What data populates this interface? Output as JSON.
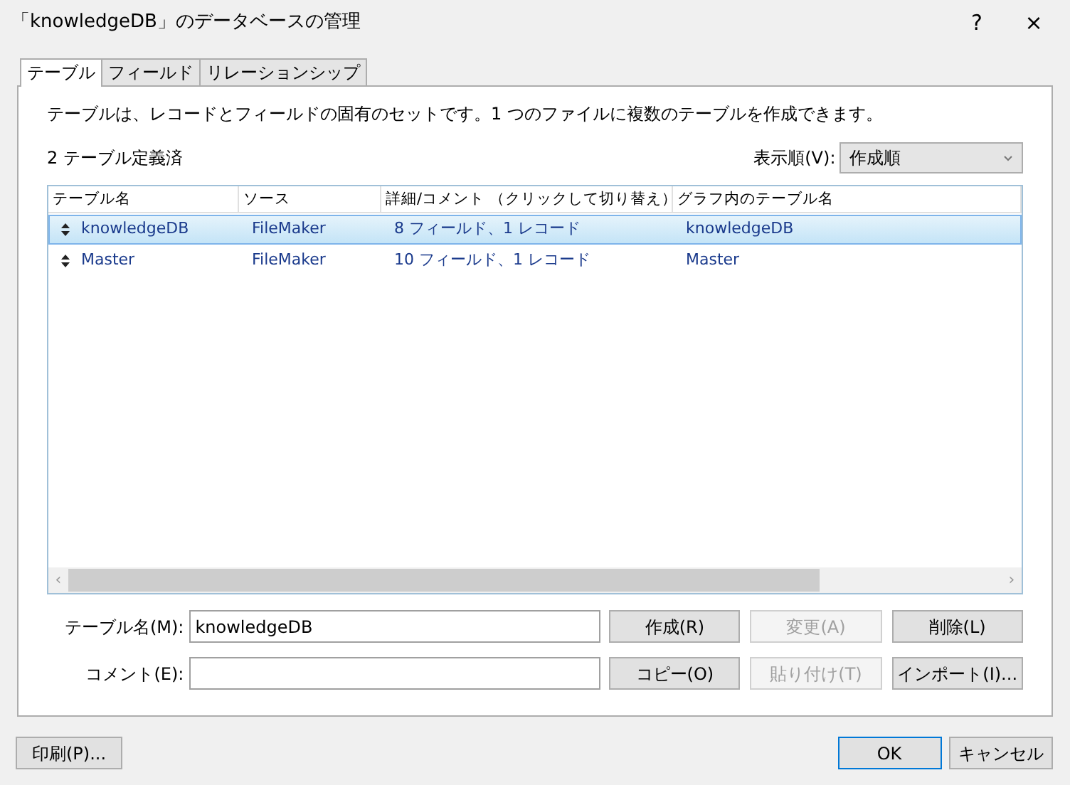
{
  "window": {
    "title": "「knowledgeDB」のデータベースの管理",
    "help": "?",
    "close": "×"
  },
  "tabs": [
    {
      "label": "テーブル",
      "selected": true
    },
    {
      "label": "フィールド",
      "selected": false
    },
    {
      "label": "リレーションシップ",
      "selected": false
    }
  ],
  "description": "テーブルは、レコードとフィールドの固有のセットです。1 つのファイルに複数のテーブルを作成できます。",
  "count_label": "2 テーブル定義済",
  "sort": {
    "label": "表示順(V):",
    "value": "作成順"
  },
  "table": {
    "columns": [
      "テーブル名",
      "ソース",
      "詳細/コメント （クリックして切り替え）",
      "グラフ内のテーブル名"
    ],
    "rows": [
      {
        "cells": [
          "knowledgeDB",
          "FileMaker",
          "8 フィールド、1 レコード",
          "knowledgeDB"
        ],
        "selected": true
      },
      {
        "cells": [
          "Master",
          "FileMaker",
          "10 フィールド、1 レコード",
          "Master"
        ],
        "selected": false
      }
    ],
    "scroll_left": "‹",
    "scroll_right": "›"
  },
  "fields": [
    {
      "label": "テーブル名(M):",
      "value": "knowledgeDB"
    },
    {
      "label": "コメント(E):"
    }
  ],
  "action_buttons": [
    {
      "label": "作成(R)",
      "disabled": false
    },
    {
      "label": "変更(A)",
      "disabled": true
    },
    {
      "label": "削除(L)",
      "disabled": false
    },
    {
      "label": "コピー(O)",
      "disabled": false
    },
    {
      "label": "貼り付け(T)",
      "disabled": true
    },
    {
      "label": "インポート(I)...",
      "disabled": false
    }
  ],
  "footer": {
    "print": "印刷(P)...",
    "ok": "OK",
    "cancel": "キャンセル"
  }
}
